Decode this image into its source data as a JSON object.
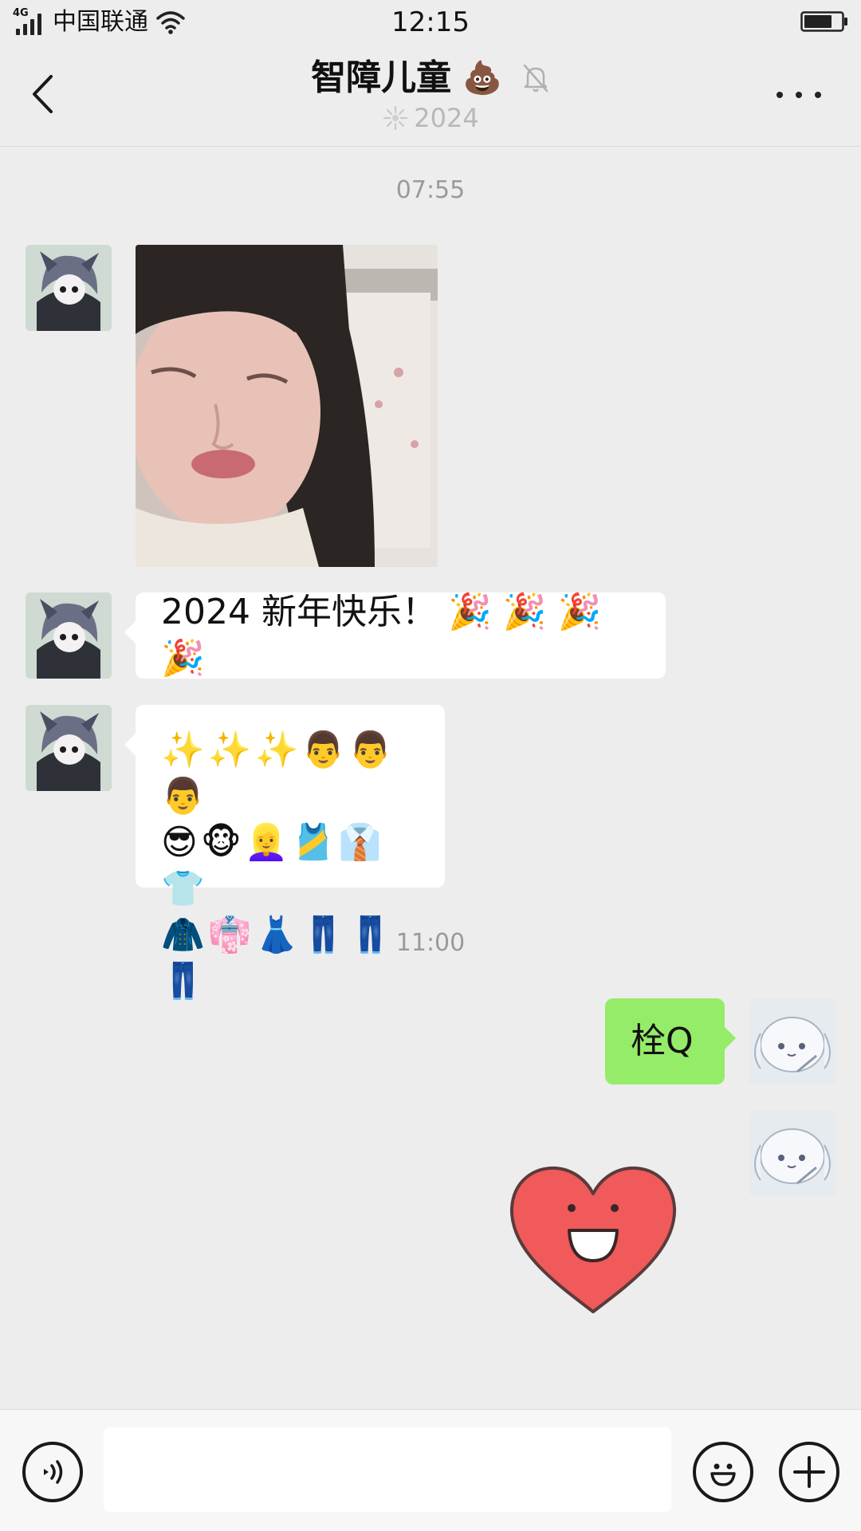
{
  "status_bar": {
    "network": "4G",
    "carrier": "中国联通",
    "time": "12:15",
    "icons": [
      "signal-icon",
      "wifi-icon",
      "battery-icon"
    ]
  },
  "header": {
    "title": "智障儿童",
    "title_emoji": "💩",
    "subtitle": "2024",
    "icons": [
      "back-icon",
      "mute-bell-icon",
      "firework-icon",
      "more-icon"
    ]
  },
  "messages": [
    {
      "type": "timestamp",
      "text": "07:55"
    },
    {
      "type": "image",
      "sender": "other",
      "description_icon": "photo-icon"
    },
    {
      "type": "text",
      "sender": "other",
      "text": "2024 新年快乐！ 🎉 🎉 🎉 🎉"
    },
    {
      "type": "emoji",
      "sender": "other",
      "lines": [
        "✨✨✨👨👨👨",
        "😎🐵👱‍♀️🎽👔👕",
        "🧥👘👗👖👖👖"
      ]
    },
    {
      "type": "timestamp",
      "text": "11:00"
    },
    {
      "type": "text",
      "sender": "me",
      "text": "栓Q"
    },
    {
      "type": "sticker",
      "sender": "me",
      "sticker": "heart-smile-sticker"
    }
  ],
  "input_bar": {
    "placeholder": "",
    "icons": [
      "voice-icon",
      "emoji-icon",
      "plus-icon"
    ]
  },
  "colors": {
    "background": "#ededed",
    "bubble_me": "#95ec69",
    "bubble_other": "#ffffff",
    "timestamp": "#9a9a9a",
    "heart": "#f05a5a"
  }
}
